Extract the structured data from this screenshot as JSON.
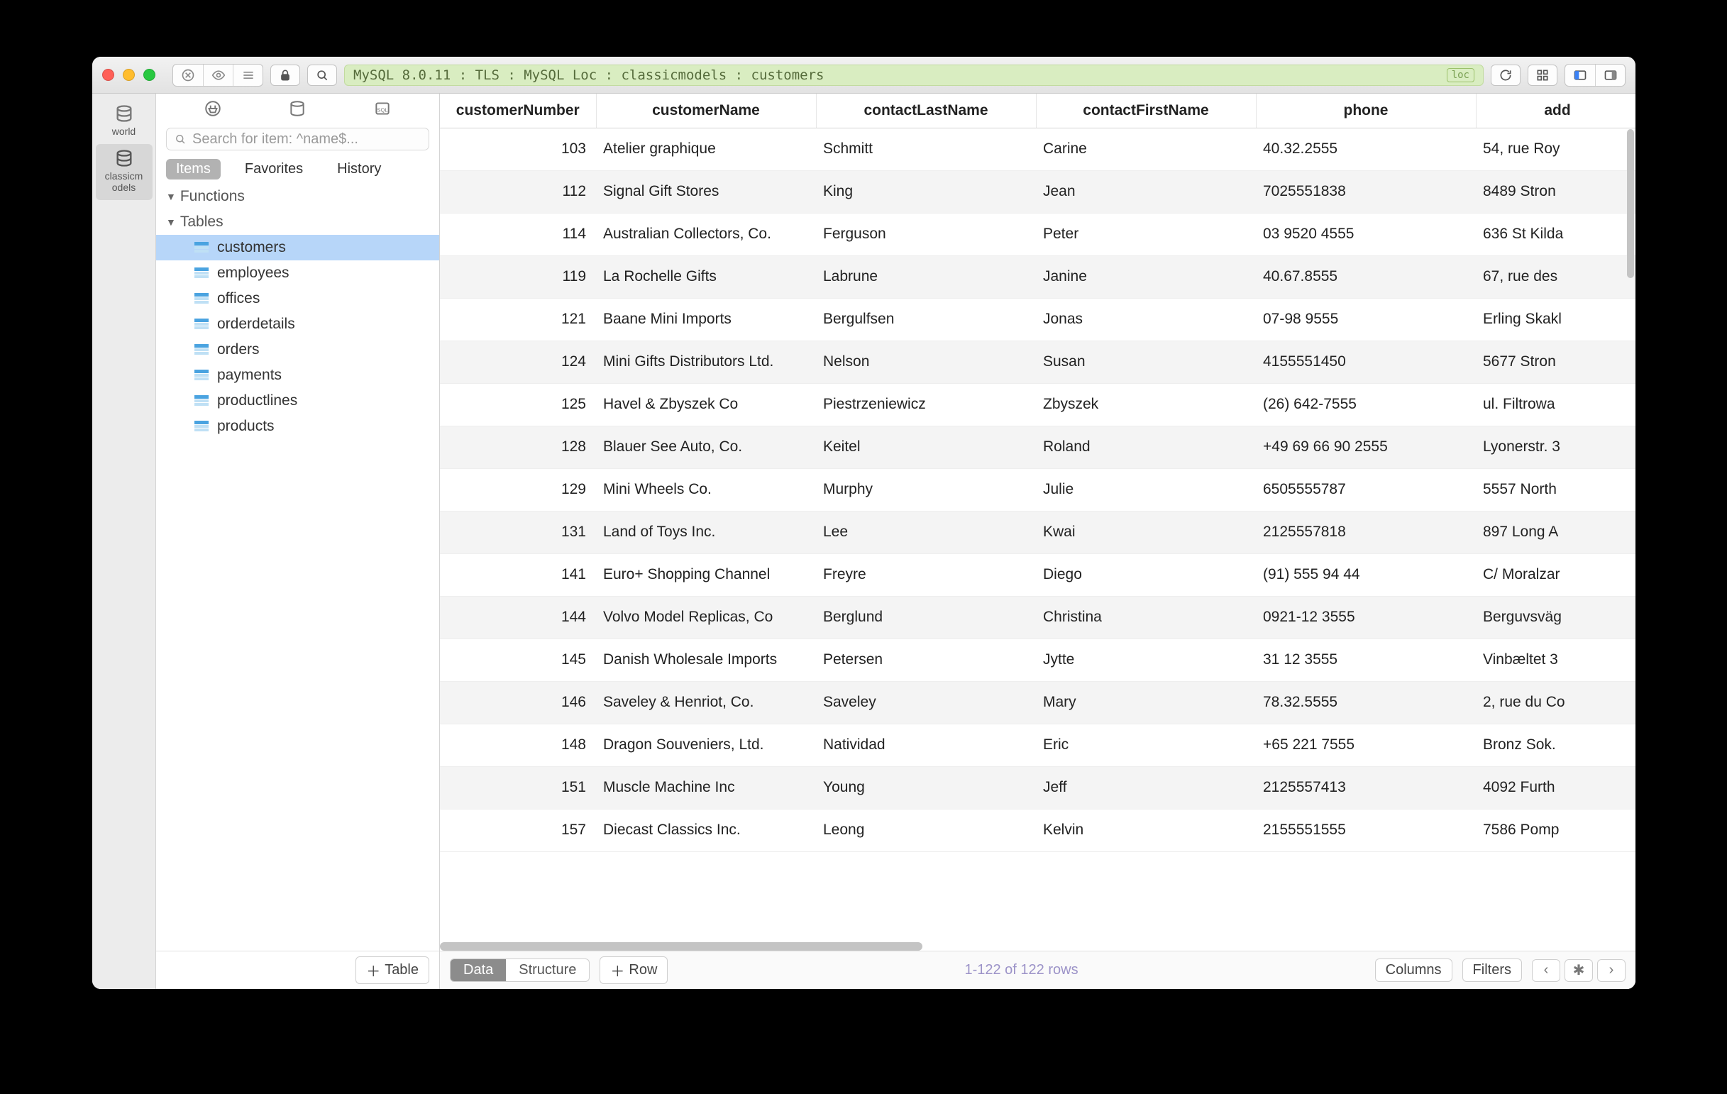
{
  "toolbar": {
    "path": "MySQL 8.0.11 : TLS : MySQL Loc : classicmodels : customers",
    "badge": "loc"
  },
  "dbrail": {
    "items": [
      {
        "label": "world",
        "active": false
      },
      {
        "label": "classicm\nodels",
        "active": true
      }
    ]
  },
  "sidebar": {
    "search_placeholder": "Search for item: ^name$...",
    "tabs": {
      "items": "Items",
      "favorites": "Favorites",
      "history": "History"
    },
    "groups": {
      "functions": "Functions",
      "tables": "Tables"
    },
    "tables": [
      "customers",
      "employees",
      "offices",
      "orderdetails",
      "orders",
      "payments",
      "productlines",
      "products"
    ],
    "active_table": "customers",
    "add_table_label": "Table"
  },
  "columns": [
    "customerNumber",
    "customerName",
    "contactLastName",
    "contactFirstName",
    "phone",
    "add"
  ],
  "rows": [
    {
      "n": "103",
      "name": "Atelier graphique",
      "last": "Schmitt",
      "first": "Carine",
      "phone": "40.32.2555",
      "addr": "54, rue Roy"
    },
    {
      "n": "112",
      "name": "Signal Gift Stores",
      "last": "King",
      "first": "Jean",
      "phone": "7025551838",
      "addr": "8489 Stron"
    },
    {
      "n": "114",
      "name": "Australian Collectors, Co.",
      "last": "Ferguson",
      "first": "Peter",
      "phone": "03 9520 4555",
      "addr": "636 St Kilda"
    },
    {
      "n": "119",
      "name": "La Rochelle Gifts",
      "last": "Labrune",
      "first": "Janine",
      "phone": "40.67.8555",
      "addr": "67, rue des"
    },
    {
      "n": "121",
      "name": "Baane Mini Imports",
      "last": "Bergulfsen",
      "first": "Jonas",
      "phone": "07-98 9555",
      "addr": "Erling Skakl"
    },
    {
      "n": "124",
      "name": "Mini Gifts Distributors Ltd.",
      "last": "Nelson",
      "first": "Susan",
      "phone": "4155551450",
      "addr": "5677 Stron"
    },
    {
      "n": "125",
      "name": "Havel & Zbyszek Co",
      "last": "Piestrzeniewicz",
      "first": "Zbyszek",
      "phone": "(26) 642-7555",
      "addr": "ul. Filtrowa"
    },
    {
      "n": "128",
      "name": "Blauer See Auto, Co.",
      "last": "Keitel",
      "first": "Roland",
      "phone": "+49 69 66 90 2555",
      "addr": "Lyonerstr. 3"
    },
    {
      "n": "129",
      "name": "Mini Wheels Co.",
      "last": "Murphy",
      "first": "Julie",
      "phone": "6505555787",
      "addr": "5557 North"
    },
    {
      "n": "131",
      "name": "Land of Toys Inc.",
      "last": "Lee",
      "first": "Kwai",
      "phone": "2125557818",
      "addr": "897 Long A"
    },
    {
      "n": "141",
      "name": "Euro+ Shopping Channel",
      "last": "Freyre",
      "first": "Diego",
      "phone": "(91) 555 94 44",
      "addr": "C/ Moralzar"
    },
    {
      "n": "144",
      "name": "Volvo Model Replicas, Co",
      "last": "Berglund",
      "first": "Christina",
      "phone": "0921-12 3555",
      "addr": "Berguvsväg"
    },
    {
      "n": "145",
      "name": "Danish Wholesale Imports",
      "last": "Petersen",
      "first": "Jytte",
      "phone": "31 12 3555",
      "addr": "Vinbæltet 3"
    },
    {
      "n": "146",
      "name": "Saveley & Henriot, Co.",
      "last": "Saveley",
      "first": "Mary",
      "phone": "78.32.5555",
      "addr": "2, rue du Co"
    },
    {
      "n": "148",
      "name": "Dragon Souveniers, Ltd.",
      "last": "Natividad",
      "first": "Eric",
      "phone": "+65 221 7555",
      "addr": "Bronz Sok."
    },
    {
      "n": "151",
      "name": "Muscle Machine Inc",
      "last": "Young",
      "first": "Jeff",
      "phone": "2125557413",
      "addr": "4092 Furth"
    },
    {
      "n": "157",
      "name": "Diecast Classics Inc.",
      "last": "Leong",
      "first": "Kelvin",
      "phone": "2155551555",
      "addr": "7586 Pomp"
    }
  ],
  "footer": {
    "data": "Data",
    "structure": "Structure",
    "add_row": "Row",
    "status": "1-122 of 122 rows",
    "columns_btn": "Columns",
    "filters_btn": "Filters"
  }
}
